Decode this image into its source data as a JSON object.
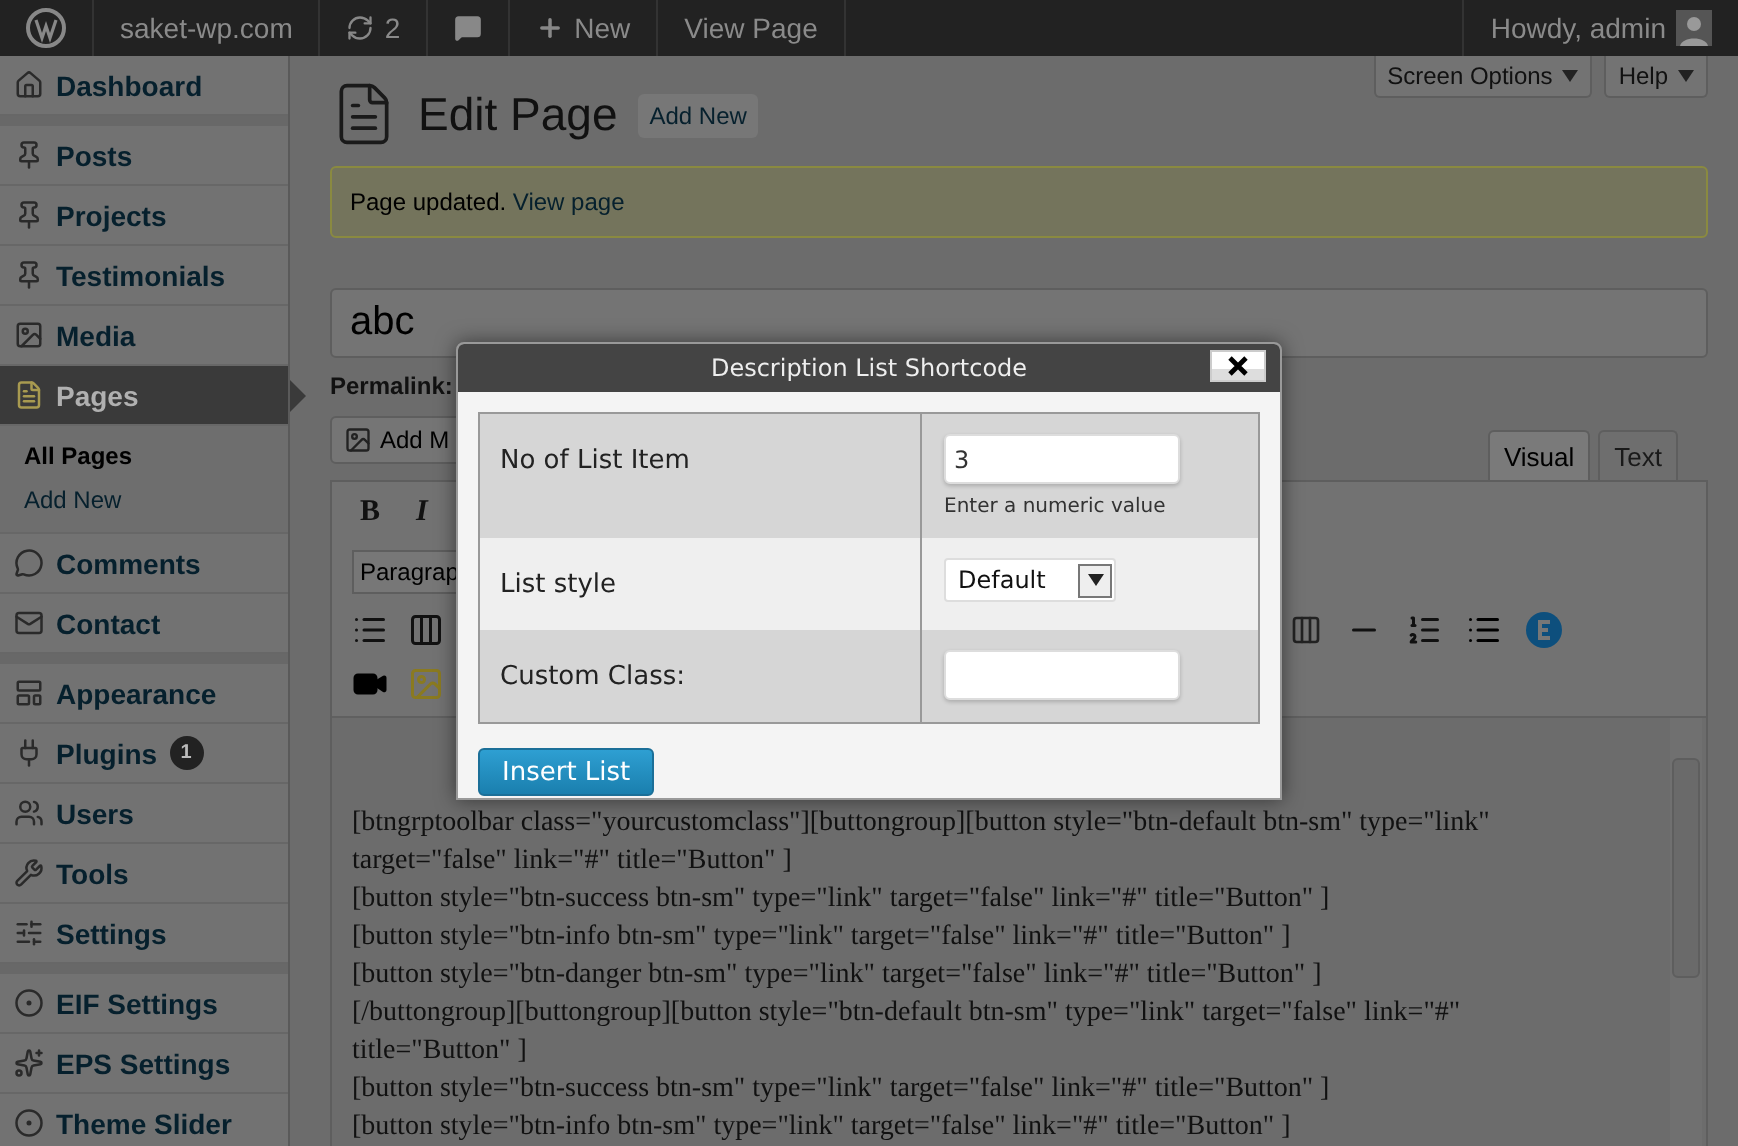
{
  "admin_bar": {
    "site": "saket-wp.com",
    "updates": "2",
    "new": "New",
    "view": "View Page",
    "greeting": "Howdy, admin"
  },
  "sidebar": {
    "groups": [
      {
        "items": [
          {
            "label": "Dashboard",
            "selected": false
          }
        ]
      },
      {
        "items": [
          {
            "label": "Posts",
            "selected": false
          },
          {
            "label": "Projects",
            "selected": false
          },
          {
            "label": "Testimonials",
            "selected": false
          },
          {
            "label": "Media",
            "selected": false
          },
          {
            "label": "Pages",
            "selected": true,
            "children": [
              {
                "label": "All Pages",
                "selected": true
              },
              {
                "label": "Add New",
                "selected": false
              }
            ]
          },
          {
            "label": "Comments",
            "selected": false
          },
          {
            "label": "Contact",
            "selected": false
          }
        ]
      },
      {
        "items": [
          {
            "label": "Appearance",
            "selected": false
          },
          {
            "label": "Plugins",
            "selected": false,
            "badge": "1"
          },
          {
            "label": "Users",
            "selected": false
          },
          {
            "label": "Tools",
            "selected": false
          },
          {
            "label": "Settings",
            "selected": false
          }
        ]
      },
      {
        "items": [
          {
            "label": "EIF Settings",
            "selected": false
          },
          {
            "label": "EPS Settings",
            "selected": false
          },
          {
            "label": "Theme Slider",
            "selected": false
          }
        ]
      }
    ]
  },
  "screen_meta": [
    "Screen Options",
    "Help"
  ],
  "header": {
    "title": "Edit Page",
    "add_new": "Add New"
  },
  "notice": {
    "text": "Page updated.",
    "link": "View page"
  },
  "title_field": {
    "value": "abc"
  },
  "permalink": "Permalink:",
  "add_media": "Add M",
  "editor_tabs": [
    {
      "label": "Visual",
      "selected": true
    },
    {
      "label": "Text",
      "selected": false
    }
  ],
  "toolbar": {
    "letters": [
      "B",
      "I"
    ],
    "format": "Paragrap"
  },
  "content_lines": [
    "[btngrptoolbar class=\"yourcustomclass\"][buttongroup][button style=\"btn-default btn-sm\" type=\"link\"",
    "target=\"false\" link=\"#\" title=\"Button\" ]",
    "[button style=\"btn-success btn-sm\" type=\"link\" target=\"false\" link=\"#\" title=\"Button\" ]",
    "[button style=\"btn-info btn-sm\" type=\"link\" target=\"false\" link=\"#\" title=\"Button\" ]",
    "[button style=\"btn-danger btn-sm\" type=\"link\" target=\"false\" link=\"#\" title=\"Button\" ]",
    "[/buttongroup][buttongroup][button style=\"btn-default btn-sm\" type=\"link\" target=\"false\" link=\"#\"",
    "title=\"Button\" ]",
    "[button style=\"btn-success btn-sm\" type=\"link\" target=\"false\" link=\"#\" title=\"Button\" ]",
    "[button style=\"btn-info btn-sm\" type=\"link\" target=\"false\" link=\"#\" title=\"Button\" ]"
  ],
  "dialog": {
    "title": "Description List Shortcode",
    "fields": [
      {
        "kind": "text",
        "label": "No of List Item",
        "value": "3",
        "hint": "Enter a numeric value"
      },
      {
        "kind": "select",
        "label": "List style",
        "value": "Default"
      },
      {
        "kind": "text",
        "label": "Custom Class:"
      }
    ],
    "button": "Insert List"
  }
}
